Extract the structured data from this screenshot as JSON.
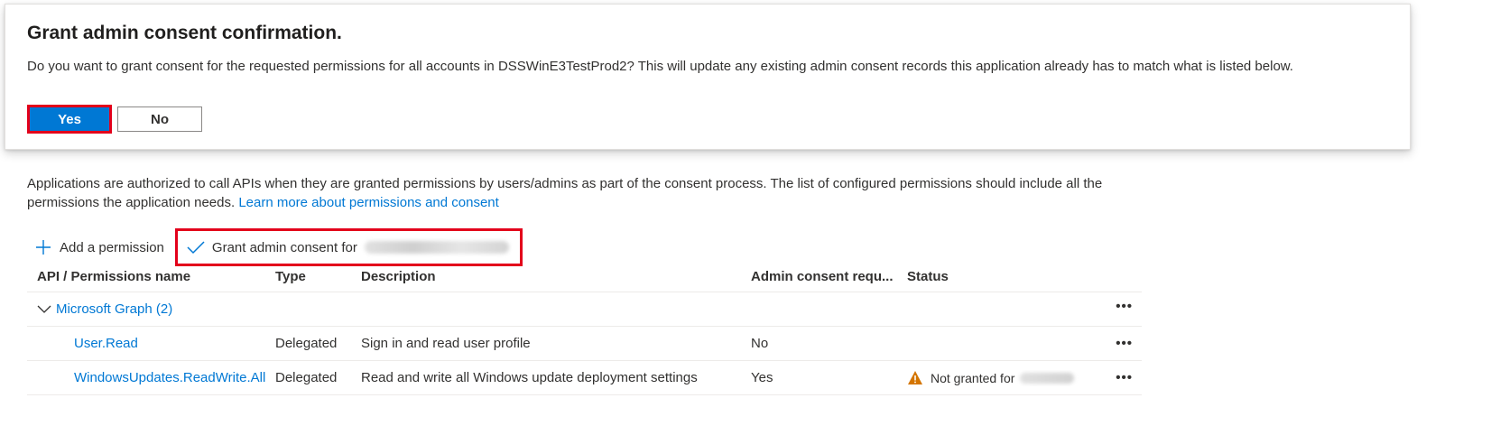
{
  "dialog": {
    "title": "Grant admin consent confirmation.",
    "message": "Do you want to grant consent for the requested permissions for all accounts in DSSWinE3TestProd2? This will update any existing admin consent records this application already has to match what is listed below.",
    "yes_label": "Yes",
    "no_label": "No"
  },
  "intro": {
    "text": "Applications are authorized to call APIs when they are granted permissions by users/admins as part of the consent process. The list of configured permissions should include all the permissions the application needs.",
    "link": "Learn more about permissions and consent"
  },
  "toolbar": {
    "add_label": "Add a permission",
    "grant_label": "Grant admin consent for"
  },
  "table": {
    "headers": [
      "API / Permissions name",
      "Type",
      "Description",
      "Admin consent requ...",
      "Status"
    ],
    "group": "Microsoft Graph (2)",
    "rows": [
      {
        "name": "User.Read",
        "type": "Delegated",
        "description": "Sign in and read user profile",
        "admin_consent": "No",
        "status": ""
      },
      {
        "name": "WindowsUpdates.ReadWrite.All",
        "type": "Delegated",
        "description": "Read and write all Windows update deployment settings",
        "admin_consent": "Yes",
        "status": "Not granted for"
      }
    ],
    "more_label": "•••"
  },
  "colors": {
    "accent": "#0078d4",
    "highlight": "#e3001b",
    "warning": "#d47500"
  }
}
